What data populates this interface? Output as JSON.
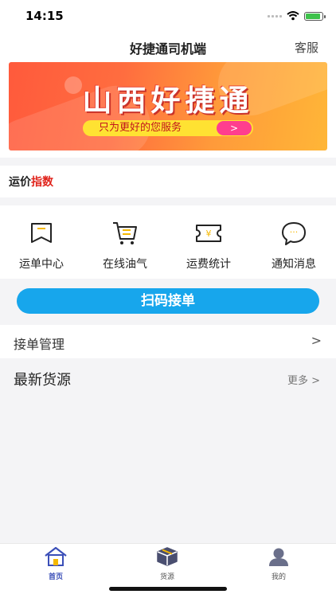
{
  "status_bar": {
    "time": "14:15"
  },
  "nav": {
    "title": "好捷通司机端",
    "right_action": "客服"
  },
  "banner": {
    "title": "山西好捷通",
    "subtitle": "只为更好的您服务",
    "arrow": ">"
  },
  "freight_index": {
    "title_part1": "运价",
    "title_part2": "指数"
  },
  "menu": [
    {
      "label": "运单中心",
      "icon": "waybill-icon"
    },
    {
      "label": "在线油气",
      "icon": "cart-icon"
    },
    {
      "label": "运费统计",
      "icon": "ticket-icon",
      "glyph": "¥"
    },
    {
      "label": "通知消息",
      "icon": "message-icon",
      "glyph": "···"
    }
  ],
  "scan_button": {
    "label": "扫码接单"
  },
  "order_management": {
    "label": "接单管理",
    "chevron": ">"
  },
  "latest_cargo": {
    "title": "最新货源",
    "more": "更多 >"
  },
  "tabbar": [
    {
      "label": "首页",
      "icon": "home-icon",
      "active": true
    },
    {
      "label": "货源",
      "icon": "box-icon",
      "active": false
    },
    {
      "label": "我的",
      "icon": "user-icon",
      "active": false
    }
  ],
  "colors": {
    "accent": "#17a6ec",
    "active_tab": "#3b4fb8",
    "index_red": "#e0241c",
    "battery": "#3ec24b"
  }
}
